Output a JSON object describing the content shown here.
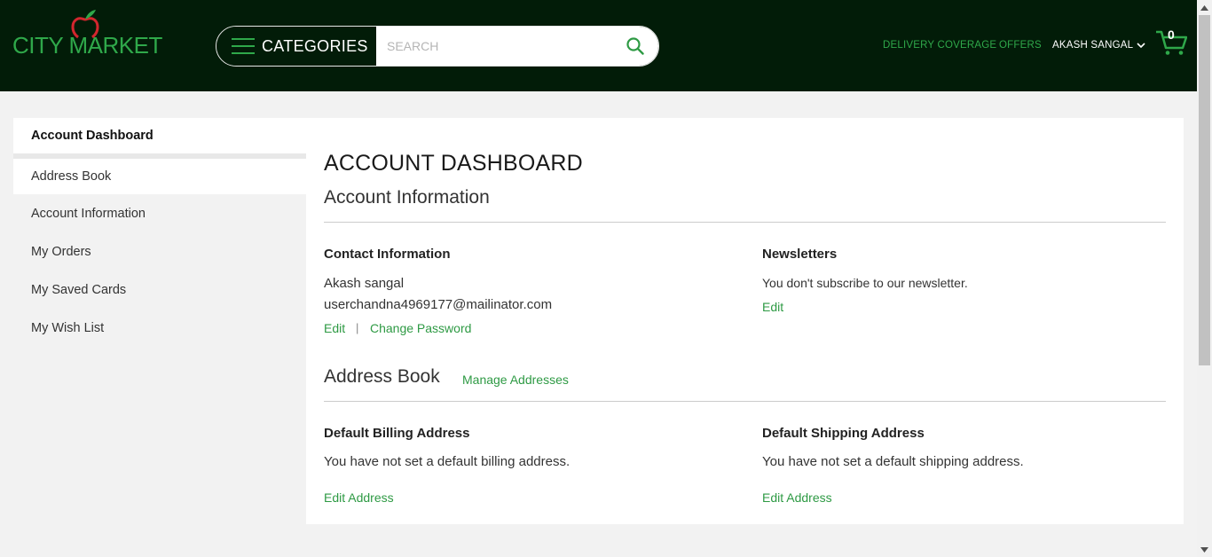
{
  "header": {
    "logo_text": "CITY MARKET",
    "categories_label": "CATEGORIES",
    "search_placeholder": "SEARCH",
    "delivery_label": "DELIVERY COVERAGE",
    "offers_label": "OFFERS",
    "user_label": "AKASH SANGAL",
    "cart_count": "0",
    "colors": {
      "bg": "#021c08",
      "accent": "#2fa84a"
    }
  },
  "sidebar": {
    "items": [
      {
        "label": "Account Dashboard"
      },
      {
        "label": "Address Book"
      },
      {
        "label": "Account Information"
      },
      {
        "label": "My Orders"
      },
      {
        "label": "My Saved Cards"
      },
      {
        "label": "My Wish List"
      }
    ]
  },
  "main": {
    "page_title": "ACCOUNT DASHBOARD",
    "account_info_title": "Account Information",
    "contact": {
      "title": "Contact Information",
      "name": "Akash sangal",
      "email": "userchandna4969177@mailinator.com",
      "edit_label": "Edit",
      "separator": "|",
      "change_password_label": "Change Password"
    },
    "newsletters": {
      "title": "Newsletters",
      "text": "You don't subscribe to our newsletter.",
      "edit_label": "Edit"
    },
    "address_book": {
      "title": "Address Book",
      "manage_label": "Manage Addresses",
      "billing_title": "Default Billing Address",
      "billing_text": "You have not set a default billing address.",
      "billing_edit": "Edit Address",
      "shipping_title": "Default Shipping Address",
      "shipping_text": "You have not set a default shipping address.",
      "shipping_edit": "Edit Address"
    }
  }
}
